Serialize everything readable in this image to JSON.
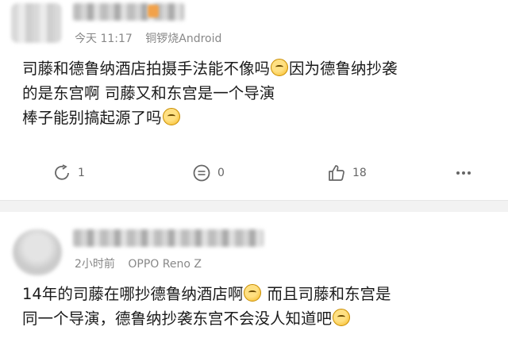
{
  "posts": [
    {
      "time": "今天 11:17",
      "device": "铜锣烧Android",
      "lines": [
        "司藤和德鲁纳酒店拍摄手法能不像吗",
        "因为德鲁纳抄袭",
        "的是东宫啊  司藤又和东宫是一个导演",
        "棒子能别搞起源了吗"
      ],
      "actions": {
        "repost_count": "1",
        "comment_count": "0",
        "like_count": "18"
      }
    },
    {
      "time": "2小时前",
      "device": "OPPO Reno Z",
      "lines": [
        "14年的司藤在哪抄德鲁纳酒店啊",
        "  而且司藤和东宫是",
        "同一个导演，德鲁纳抄袭东宫不会没人知道吧"
      ]
    }
  ],
  "icons": {
    "repost": "repost-icon",
    "comment": "comment-icon",
    "like": "thumbs-up-icon",
    "more": "more-dots-icon"
  },
  "colors": {
    "text": "#1b1b1b",
    "meta": "#888888",
    "separator": "#f2f2f2"
  }
}
